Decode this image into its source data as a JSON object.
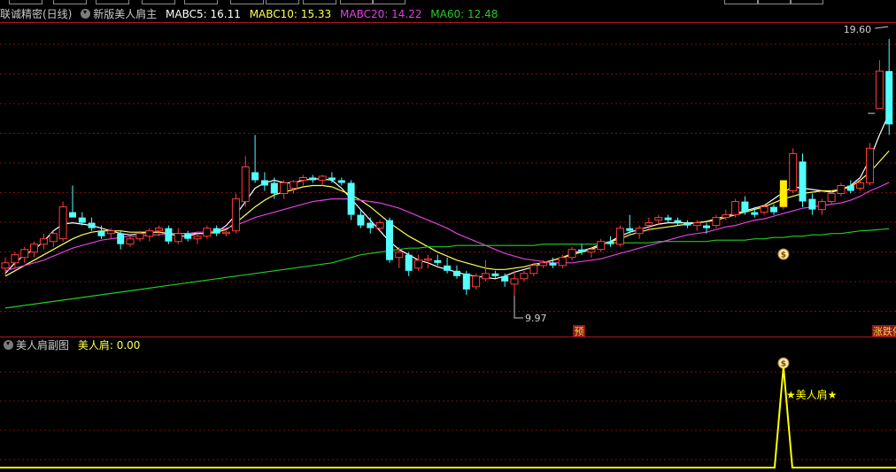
{
  "toolbar_top": {
    "buttons": [
      "",
      "",
      "",
      "",
      "",
      "",
      "",
      "",
      "",
      "",
      "",
      "",
      ""
    ]
  },
  "main_header": {
    "stock_title": "联诚精密(日线)",
    "indicator_name": "新版美人肩主",
    "ma5": {
      "label": "MABC5:",
      "value": "16.11",
      "color": "#ffffff"
    },
    "ma10": {
      "label": "MABC10:",
      "value": "15.33",
      "color": "#ffff55"
    },
    "ma20": {
      "label": "MABC20:",
      "value": "14.22",
      "color": "#e040e0"
    },
    "ma60": {
      "label": "MA60:",
      "value": "12.48",
      "color": "#22cc22"
    }
  },
  "price_labels": {
    "high": "19.60",
    "low": "9.97"
  },
  "tags": {
    "yu": "预",
    "zhangting": "涨跌停"
  },
  "sub_header": {
    "title": "美人肩副图",
    "label": "美人肩:",
    "value": "0.00"
  },
  "signal_text": "★美人肩★",
  "colors": {
    "up": "#ff3c3c",
    "down": "#54ffff",
    "grid": "#7a1010",
    "divider": "#b01818",
    "sub_line": "#ffff00"
  },
  "chart_data": {
    "type": "candlestick",
    "ylim": [
      8.5,
      20.2
    ],
    "candles": [
      [
        11.0,
        11.4,
        10.7,
        11.2
      ],
      [
        11.2,
        11.6,
        11.0,
        11.5
      ],
      [
        11.4,
        11.8,
        11.2,
        11.7
      ],
      [
        11.6,
        12.0,
        11.4,
        11.9
      ],
      [
        11.9,
        12.3,
        11.7,
        12.1
      ],
      [
        12.0,
        12.4,
        11.8,
        12.3
      ],
      [
        12.1,
        13.5,
        12.0,
        13.3
      ],
      [
        13.1,
        14.1,
        12.9,
        12.9
      ],
      [
        12.9,
        13.1,
        12.6,
        12.7
      ],
      [
        12.7,
        12.9,
        12.4,
        12.5
      ],
      [
        12.4,
        12.6,
        12.1,
        12.2
      ],
      [
        12.3,
        12.5,
        12.1,
        12.4
      ],
      [
        12.3,
        12.4,
        11.7,
        11.9
      ],
      [
        11.9,
        12.2,
        11.8,
        12.1
      ],
      [
        12.1,
        12.4,
        12.0,
        12.3
      ],
      [
        12.2,
        12.5,
        12.0,
        12.4
      ],
      [
        12.4,
        12.6,
        12.2,
        12.5
      ],
      [
        12.5,
        12.6,
        11.9,
        12.0
      ],
      [
        12.0,
        12.5,
        11.9,
        12.3
      ],
      [
        12.3,
        12.4,
        12.0,
        12.1
      ],
      [
        12.1,
        12.3,
        11.9,
        12.2
      ],
      [
        12.2,
        12.6,
        12.1,
        12.5
      ],
      [
        12.5,
        12.6,
        12.2,
        12.3
      ],
      [
        12.3,
        12.4,
        12.2,
        12.35
      ],
      [
        12.4,
        13.8,
        12.3,
        13.6
      ],
      [
        13.5,
        15.2,
        13.3,
        14.8
      ],
      [
        14.6,
        16.0,
        14.2,
        14.3
      ],
      [
        14.3,
        14.6,
        13.9,
        14.1
      ],
      [
        14.2,
        14.4,
        13.6,
        13.8
      ],
      [
        13.8,
        14.3,
        13.6,
        14.2
      ],
      [
        14.0,
        14.3,
        13.8,
        14.25
      ],
      [
        14.3,
        14.5,
        14.1,
        14.4
      ],
      [
        14.4,
        14.5,
        14.2,
        14.3
      ],
      [
        14.3,
        14.5,
        14.1,
        14.45
      ],
      [
        14.4,
        14.6,
        14.2,
        14.3
      ],
      [
        14.3,
        14.4,
        14.1,
        14.2
      ],
      [
        14.2,
        14.3,
        12.8,
        13.0
      ],
      [
        13.0,
        13.2,
        12.5,
        12.6
      ],
      [
        12.7,
        12.9,
        12.3,
        12.5
      ],
      [
        12.5,
        12.8,
        12.4,
        12.7
      ],
      [
        12.8,
        12.9,
        11.2,
        11.3
      ],
      [
        11.4,
        11.8,
        11.0,
        11.6
      ],
      [
        11.5,
        11.6,
        10.7,
        10.9
      ],
      [
        11.0,
        11.5,
        10.9,
        11.3
      ],
      [
        11.3,
        11.5,
        11.0,
        11.35
      ],
      [
        11.3,
        11.5,
        11.1,
        11.2
      ],
      [
        11.1,
        11.4,
        10.8,
        10.9
      ],
      [
        10.9,
        11.1,
        10.6,
        10.7
      ],
      [
        10.8,
        10.9,
        10.0,
        10.2
      ],
      [
        10.3,
        10.8,
        10.2,
        10.7
      ],
      [
        10.6,
        11.3,
        10.5,
        10.8
      ],
      [
        10.8,
        10.9,
        10.6,
        10.7
      ],
      [
        10.7,
        10.8,
        10.3,
        10.5
      ],
      [
        10.4,
        10.9,
        9.97,
        10.6
      ],
      [
        10.6,
        10.9,
        10.5,
        10.8
      ],
      [
        10.8,
        11.2,
        10.7,
        11.1
      ],
      [
        11.1,
        11.3,
        11.0,
        11.2
      ],
      [
        11.2,
        11.4,
        11.0,
        11.1
      ],
      [
        11.1,
        11.5,
        11.0,
        11.4
      ],
      [
        11.4,
        11.8,
        11.3,
        11.7
      ],
      [
        11.7,
        11.9,
        11.5,
        11.6
      ],
      [
        11.6,
        11.8,
        11.4,
        11.7
      ],
      [
        11.7,
        12.1,
        11.6,
        12.0
      ],
      [
        12.0,
        12.2,
        11.8,
        11.9
      ],
      [
        11.9,
        12.6,
        11.8,
        12.5
      ],
      [
        12.5,
        13.0,
        12.3,
        12.4
      ],
      [
        12.3,
        12.6,
        12.1,
        12.5
      ],
      [
        12.6,
        12.9,
        12.4,
        12.7
      ],
      [
        12.8,
        13.0,
        12.6,
        12.9
      ],
      [
        12.9,
        13.0,
        12.7,
        12.8
      ],
      [
        12.8,
        12.9,
        12.6,
        12.7
      ],
      [
        12.7,
        12.8,
        12.5,
        12.6
      ],
      [
        12.6,
        12.8,
        12.4,
        12.7
      ],
      [
        12.6,
        12.7,
        12.3,
        12.5
      ],
      [
        12.6,
        13.0,
        12.5,
        12.9
      ],
      [
        12.9,
        13.2,
        12.8,
        13.0
      ],
      [
        13.0,
        13.6,
        12.9,
        13.5
      ],
      [
        13.5,
        13.7,
        13.0,
        13.1
      ],
      [
        13.1,
        13.3,
        12.9,
        13.0
      ],
      [
        13.1,
        13.4,
        13.0,
        13.3
      ],
      [
        13.3,
        13.4,
        13.0,
        13.1
      ],
      [
        13.3,
        14.0,
        13.2,
        13.9
      ],
      [
        13.9,
        15.5,
        13.8,
        15.3
      ],
      [
        15.0,
        15.3,
        13.3,
        13.5
      ],
      [
        13.6,
        13.8,
        13.0,
        13.2
      ],
      [
        13.2,
        13.6,
        13.0,
        13.5
      ],
      [
        13.5,
        13.9,
        13.4,
        13.8
      ],
      [
        13.8,
        14.2,
        13.7,
        14.1
      ],
      [
        14.1,
        14.3,
        13.8,
        13.9
      ],
      [
        14.0,
        14.3,
        13.9,
        14.2
      ],
      [
        14.2,
        15.7,
        14.1,
        15.5
      ],
      [
        17.0,
        18.8,
        17.0,
        18.4
      ],
      [
        18.4,
        19.6,
        16.0,
        16.4
      ]
    ],
    "ma_series": [
      {
        "name": "MABC5",
        "color": "#ffffff",
        "values": [
          10.8,
          11.2,
          11.5,
          11.7,
          12.0,
          12.4,
          12.65,
          12.7,
          12.65,
          12.6,
          12.5,
          12.4,
          12.3,
          12.25,
          12.3,
          12.35,
          12.35,
          12.3,
          12.2,
          12.2,
          12.3,
          12.3,
          12.35,
          12.6,
          13.0,
          13.5,
          14.0,
          14.2,
          14.3,
          14.2,
          14.2,
          14.3,
          14.35,
          14.35,
          14.3,
          14.0,
          13.6,
          13.2,
          12.8,
          12.4,
          12.0,
          11.7,
          11.5,
          11.3,
          11.2,
          11.05,
          10.95,
          10.85,
          10.75,
          10.7,
          10.65,
          10.6,
          10.7,
          10.85,
          10.95,
          11.05,
          11.2,
          11.3,
          11.4,
          11.55,
          11.65,
          11.75,
          11.9,
          12.0,
          12.2,
          12.35,
          12.45,
          12.55,
          12.65,
          12.7,
          12.7,
          12.7,
          12.7,
          12.75,
          12.85,
          12.95,
          13.05,
          13.15,
          13.25,
          13.35,
          13.6,
          13.85,
          14.05,
          14.0,
          13.95,
          13.9,
          13.85,
          13.95,
          14.1,
          14.4,
          15.1,
          16.0,
          16.8
        ]
      },
      {
        "name": "MABC10",
        "color": "#ffff55",
        "values": [
          10.7,
          10.9,
          11.1,
          11.3,
          11.5,
          11.7,
          11.9,
          12.1,
          12.25,
          12.35,
          12.4,
          12.4,
          12.4,
          12.35,
          12.35,
          12.35,
          12.35,
          12.3,
          12.3,
          12.3,
          12.3,
          12.3,
          12.35,
          12.45,
          12.7,
          13.0,
          13.3,
          13.55,
          13.75,
          13.85,
          13.95,
          14.05,
          14.1,
          14.1,
          14.05,
          13.9,
          13.75,
          13.55,
          13.3,
          13.0,
          12.7,
          12.45,
          12.2,
          12.0,
          11.8,
          11.6,
          11.45,
          11.3,
          11.2,
          11.1,
          11.0,
          10.95,
          10.95,
          11.0,
          11.05,
          11.15,
          11.2,
          11.3,
          11.4,
          11.5,
          11.6,
          11.7,
          11.85,
          12.0,
          12.1,
          12.25,
          12.35,
          12.45,
          12.5,
          12.55,
          12.6,
          12.65,
          12.7,
          12.75,
          12.8,
          12.9,
          13.0,
          13.1,
          13.2,
          13.3,
          13.45,
          13.6,
          13.7,
          13.8,
          13.85,
          13.9,
          13.9,
          13.95,
          14.05,
          14.3,
          14.6,
          15.0,
          15.4
        ]
      },
      {
        "name": "MABC20",
        "color": "#e040e0",
        "values": [
          10.9,
          11.0,
          11.1,
          11.2,
          11.3,
          11.45,
          11.6,
          11.75,
          11.85,
          11.95,
          12.05,
          12.1,
          12.15,
          12.2,
          12.2,
          12.25,
          12.25,
          12.3,
          12.3,
          12.3,
          12.35,
          12.35,
          12.4,
          12.5,
          12.6,
          12.75,
          12.9,
          13.0,
          13.1,
          13.2,
          13.3,
          13.4,
          13.5,
          13.55,
          13.6,
          13.6,
          13.6,
          13.55,
          13.5,
          13.45,
          13.35,
          13.25,
          13.1,
          12.95,
          12.8,
          12.65,
          12.5,
          12.3,
          12.15,
          12.0,
          11.85,
          11.7,
          11.55,
          11.45,
          11.35,
          11.3,
          11.25,
          11.2,
          11.2,
          11.2,
          11.25,
          11.3,
          11.35,
          11.45,
          11.55,
          11.65,
          11.75,
          11.85,
          11.95,
          12.05,
          12.15,
          12.25,
          12.3,
          12.35,
          12.45,
          12.55,
          12.6,
          12.7,
          12.8,
          12.85,
          12.95,
          13.05,
          13.15,
          13.25,
          13.3,
          13.35,
          13.4,
          13.45,
          13.55,
          13.7,
          13.9,
          14.05,
          14.22
        ]
      },
      {
        "name": "MA60",
        "color": "#22cc22",
        "values": [
          9.5,
          9.55,
          9.6,
          9.65,
          9.7,
          9.75,
          9.8,
          9.85,
          9.9,
          9.95,
          10.0,
          10.05,
          10.1,
          10.15,
          10.2,
          10.25,
          10.3,
          10.35,
          10.4,
          10.45,
          10.5,
          10.55,
          10.6,
          10.65,
          10.7,
          10.75,
          10.8,
          10.85,
          10.9,
          10.95,
          11.0,
          11.05,
          11.1,
          11.15,
          11.2,
          11.3,
          11.4,
          11.5,
          11.55,
          11.6,
          11.65,
          11.7,
          11.75,
          11.75,
          11.8,
          11.8,
          11.8,
          11.85,
          11.85,
          11.85,
          11.85,
          11.85,
          11.85,
          11.85,
          11.85,
          11.85,
          11.9,
          11.9,
          11.9,
          11.9,
          11.9,
          11.9,
          11.9,
          11.95,
          11.95,
          11.95,
          11.95,
          11.95,
          12.0,
          12.0,
          12.0,
          12.0,
          12.0,
          12.0,
          12.05,
          12.05,
          12.05,
          12.05,
          12.1,
          12.1,
          12.15,
          12.15,
          12.2,
          12.2,
          12.25,
          12.25,
          12.3,
          12.3,
          12.35,
          12.4,
          12.42,
          12.45,
          12.48
        ]
      }
    ],
    "sub_series": {
      "name": "美人肩",
      "peak_index": 81,
      "peak_value": 1,
      "baseline": 0
    }
  }
}
